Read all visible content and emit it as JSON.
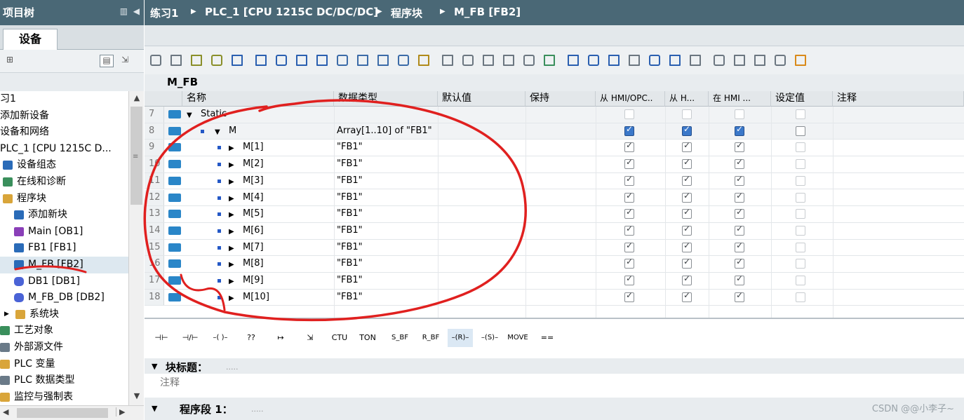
{
  "project_tree": {
    "title": "项目树",
    "tab_label": "设备",
    "items": [
      {
        "label": "习1",
        "icon": "none"
      },
      {
        "label": "添加新设备",
        "icon": "none"
      },
      {
        "label": "设备和网络",
        "icon": "none"
      },
      {
        "label": "PLC_1 [CPU 1215C D...",
        "icon": "none"
      },
      {
        "label": "设备组态",
        "icon": "device-config-icon"
      },
      {
        "label": "在线和诊断",
        "icon": "diagnostics-icon"
      },
      {
        "label": "程序块",
        "icon": "folder-icon"
      },
      {
        "label": "添加新块",
        "icon": "add-block-icon"
      },
      {
        "label": "Main [OB1]",
        "icon": "ob-block-icon"
      },
      {
        "label": "FB1 [FB1]",
        "icon": "fb-block-icon"
      },
      {
        "label": "M_FB [FB2]",
        "icon": "fb-block-icon"
      },
      {
        "label": "DB1 [DB1]",
        "icon": "db-icon"
      },
      {
        "label": "M_FB_DB [DB2]",
        "icon": "db-icon"
      },
      {
        "label": "系统块",
        "icon": "folder-icon"
      },
      {
        "label": "工艺对象",
        "icon": "tech-object-icon"
      },
      {
        "label": "外部源文件",
        "icon": "source-file-icon"
      },
      {
        "label": "PLC 变量",
        "icon": "tag-table-icon"
      },
      {
        "label": "PLC 数据类型",
        "icon": "data-type-icon"
      },
      {
        "label": "监控与强制表",
        "icon": "watch-table-icon"
      }
    ]
  },
  "breadcrumb": {
    "items": [
      "练习1",
      "PLC_1 [CPU 1215C DC/DC/DC]",
      "程序块",
      "M_FB [FB2]"
    ],
    "separator": "▶"
  },
  "editor": {
    "block_name": "M_FB",
    "columns": [
      "名称",
      "数据类型",
      "默认值",
      "保持",
      "从 HMI/OPC..",
      "从 H...",
      "在 HMI ...",
      "设定值",
      "注释"
    ],
    "rows": [
      {
        "no": "7",
        "name": "Static",
        "type": "",
        "cb": [
          "dim",
          "dim",
          "dim",
          "dim"
        ],
        "level": 0,
        "expand": "▼",
        "dot": false
      },
      {
        "no": "8",
        "name": "M",
        "type": "Array[1..10] of \"FB1\"",
        "cb": [
          "blue",
          "blue",
          "blue",
          "empty"
        ],
        "level": 1,
        "expand": "▼",
        "dot": true
      },
      {
        "no": "9",
        "name": "M[1]",
        "type": "\"FB1\"",
        "cb": [
          "on",
          "on",
          "on",
          "dim"
        ],
        "level": 2,
        "expand": "▶",
        "dot": true
      },
      {
        "no": "10",
        "name": "M[2]",
        "type": "\"FB1\"",
        "cb": [
          "on",
          "on",
          "on",
          "dim"
        ],
        "level": 2,
        "expand": "▶",
        "dot": true
      },
      {
        "no": "11",
        "name": "M[3]",
        "type": "\"FB1\"",
        "cb": [
          "on",
          "on",
          "on",
          "dim"
        ],
        "level": 2,
        "expand": "▶",
        "dot": true
      },
      {
        "no": "12",
        "name": "M[4]",
        "type": "\"FB1\"",
        "cb": [
          "on",
          "on",
          "on",
          "dim"
        ],
        "level": 2,
        "expand": "▶",
        "dot": true
      },
      {
        "no": "13",
        "name": "M[5]",
        "type": "\"FB1\"",
        "cb": [
          "on",
          "on",
          "on",
          "dim"
        ],
        "level": 2,
        "expand": "▶",
        "dot": true
      },
      {
        "no": "14",
        "name": "M[6]",
        "type": "\"FB1\"",
        "cb": [
          "on",
          "on",
          "on",
          "dim"
        ],
        "level": 2,
        "expand": "▶",
        "dot": true
      },
      {
        "no": "15",
        "name": "M[7]",
        "type": "\"FB1\"",
        "cb": [
          "on",
          "on",
          "on",
          "dim"
        ],
        "level": 2,
        "expand": "▶",
        "dot": true
      },
      {
        "no": "16",
        "name": "M[8]",
        "type": "\"FB1\"",
        "cb": [
          "on",
          "on",
          "on",
          "dim"
        ],
        "level": 2,
        "expand": "▶",
        "dot": true
      },
      {
        "no": "17",
        "name": "M[9]",
        "type": "\"FB1\"",
        "cb": [
          "on",
          "on",
          "on",
          "dim"
        ],
        "level": 2,
        "expand": "▶",
        "dot": true
      },
      {
        "no": "18",
        "name": "M[10]",
        "type": "\"FB1\"",
        "cb": [
          "on",
          "on",
          "on",
          "dim"
        ],
        "level": 2,
        "expand": "▶",
        "dot": true
      }
    ]
  },
  "instructions": [
    "⊣⊢",
    "⊣/⊢",
    "–( )–",
    "??",
    "↦",
    "⇲",
    "CTU",
    "TON",
    "S_BF",
    "R_BF",
    "–(R)–",
    "–(S)–",
    "MOVE",
    "=="
  ],
  "block_title": {
    "label": "块标题：",
    "placeholder": "....."
  },
  "comment_label": "注释",
  "network": {
    "label": "程序段 1：",
    "placeholder": "....."
  },
  "watermark": "CSDN @@小李子~",
  "colors": {
    "header_bar": "#4a6876",
    "annotation_red": "#e0201f",
    "selection": "#dde8f0",
    "checkbox_blue": "#3b78c9"
  }
}
